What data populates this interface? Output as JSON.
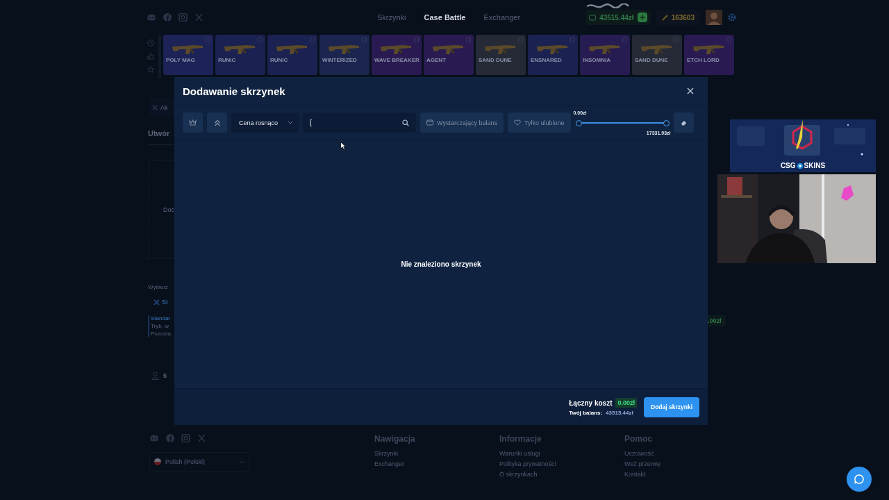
{
  "nav": [
    {
      "label": "Skrzynki",
      "selected": false
    },
    {
      "label": "Case Battle",
      "selected": true
    },
    {
      "label": "Exchanger",
      "selected": false
    }
  ],
  "wallet": {
    "balance": "43515.44zł"
  },
  "points": {
    "value": "163603"
  },
  "drops": [
    {
      "name": "POLY MAG",
      "color": "#1d2257"
    },
    {
      "name": "RUNIC",
      "color": "#1b2150"
    },
    {
      "name": "RUNIC",
      "color": "#1b2150"
    },
    {
      "name": "WINTERIZED",
      "color": "#1b2550"
    },
    {
      "name": "WAVE BREAKER",
      "color": "#291b52"
    },
    {
      "name": "AGENT",
      "color": "#291b52"
    },
    {
      "name": "SAND DUNE",
      "color": "#252a36"
    },
    {
      "name": "ENSNARED",
      "color": "#1b2150"
    },
    {
      "name": "INSOMNIA",
      "color": "#261c52"
    },
    {
      "name": "SAND DUNE",
      "color": "#252a36"
    },
    {
      "name": "ETCH LORD",
      "color": "#291b52"
    }
  ],
  "create_panel": {
    "tab": "Ak",
    "heading": "Utwór",
    "dropzone": "Doc",
    "mode_label": "Wybierz",
    "mode": "St",
    "mode_title": "Standar",
    "mode_description": [
      "Tryb, w",
      "Pozosta"
    ],
    "user": "5",
    "total": ".00zł"
  },
  "modal": {
    "title": "Dodawanie skrzynek",
    "sort": {
      "value": "Cena rosnąco"
    },
    "search": {
      "value": "["
    },
    "filters": [
      {
        "label": "Wystarczający balans",
        "kind": "wallet",
        "selected": false
      },
      {
        "label": "Tylko ulubione",
        "kind": "heart",
        "selected": false
      }
    ],
    "price_range": {
      "min_label": "0.00zł",
      "max_label": "17331.93zł",
      "handles": [
        {
          "level": 0
        },
        {
          "level": 1
        }
      ]
    },
    "empty_message": "Nie znaleziono skrzynek",
    "total": {
      "label": "Łączny koszt",
      "value": "0.00zł"
    },
    "balance": {
      "label": "Twój balans:",
      "value": "43515.44zł"
    },
    "submit": "Dodaj skrzynki"
  },
  "stream_overlay": {
    "brand_left": "CSG",
    "brand_right": "SKINS"
  },
  "footer": {
    "language": "Polish (Polski)",
    "columns": [
      {
        "title": "Nawigacja",
        "links": [
          "Skrzynki",
          "Exchanger"
        ]
      },
      {
        "title": "Informacje",
        "links": [
          "Warunki usługi",
          "Polityka prywatności",
          "O skrzynkach"
        ]
      },
      {
        "title": "Pomoc",
        "links": [
          "Uczciwość",
          "Weź przerwę",
          "Kontakt"
        ]
      }
    ]
  }
}
